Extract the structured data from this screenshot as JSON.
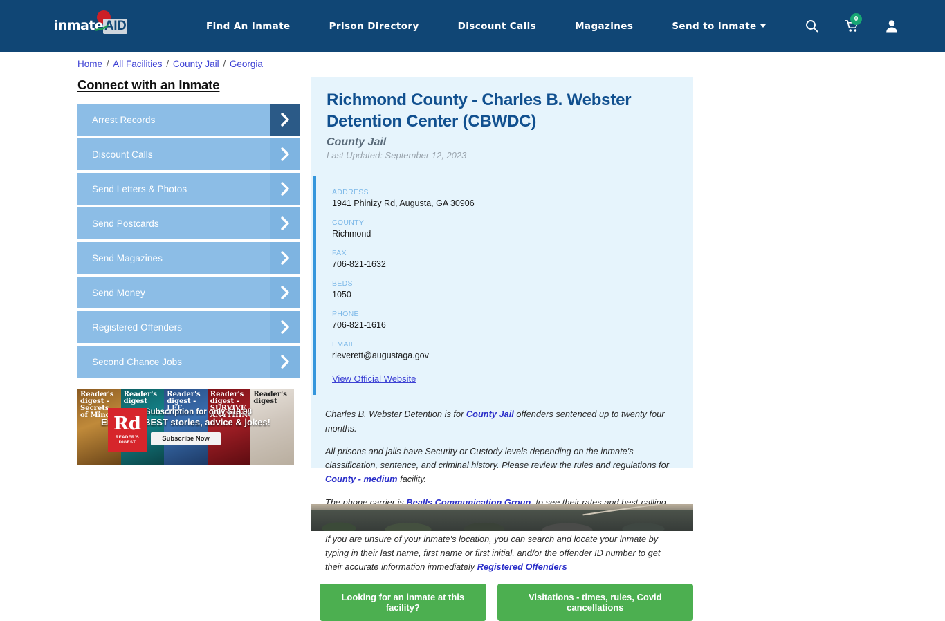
{
  "header": {
    "logo": {
      "word": "inmate",
      "aid": "AID",
      "name": "inmateAID"
    },
    "nav": [
      {
        "label": "Find An Inmate",
        "has_caret": false
      },
      {
        "label": "Prison Directory",
        "has_caret": false
      },
      {
        "label": "Discount Calls",
        "has_caret": false
      },
      {
        "label": "Magazines",
        "has_caret": false
      },
      {
        "label": "Send to Inmate",
        "has_caret": true
      }
    ],
    "icons": {
      "search": "search-icon",
      "cart": "shopping-cart-icon",
      "cart_count": "0",
      "account": "user-account-icon"
    },
    "bg_color": "#104675"
  },
  "breadcrumb": {
    "items": [
      "Home",
      "All Facilities",
      "County Jail",
      "Georgia"
    ],
    "separator": "/"
  },
  "sidebar": {
    "heading": "Connect with an Inmate",
    "items": [
      {
        "label": "Arrest Records",
        "active": true
      },
      {
        "label": "Discount Calls",
        "active": false
      },
      {
        "label": "Send Letters & Photos",
        "active": false
      },
      {
        "label": "Send Postcards",
        "active": false
      },
      {
        "label": "Send Magazines",
        "active": false
      },
      {
        "label": "Send Money",
        "active": false
      },
      {
        "label": "Registered Offenders",
        "active": false
      },
      {
        "label": "Second Chance Jobs",
        "active": false
      }
    ],
    "button_color": "#8cbde6",
    "active_arrow_color": "#2b5a87"
  },
  "ad": {
    "brand": "Reader's Digest",
    "rd_mark": "Rd",
    "rd_sub": "READER'S DIGEST",
    "line1": "1 Year Subscription for only $19.98",
    "line2": "Enjoy the BEST stories, advice & jokes!",
    "cta": "Subscribe Now",
    "covers": [
      "Reader's digest - Secrets of Mind",
      "Reader's digest",
      "Reader's digest - LEE",
      "Reader's digest - SURVIVE ANYTHING",
      "Reader's digest"
    ]
  },
  "facility": {
    "title": "Richmond County - Charles B. Webster Detention Center (CBWDC)",
    "type": "County Jail",
    "last_updated": "Last Updated: September 12, 2023",
    "info": {
      "left": [
        {
          "key": "ADDRESS",
          "value": "1941 Phinizy Rd, Augusta, GA 30906"
        },
        {
          "key": "COUNTY",
          "value": "Richmond"
        },
        {
          "key": "FAX",
          "value": "706-821-1632"
        }
      ],
      "right": [
        {
          "key": "BEDS",
          "value": "1050"
        },
        {
          "key": "PHONE",
          "value": "706-821-1616"
        },
        {
          "key": "EMAIL",
          "value": "rleverett@augustaga.gov"
        }
      ]
    },
    "official_website_link": "View Official Website",
    "accent_bar_color": "#3596dc",
    "card_bg_color": "#e6f4fc"
  },
  "body_copy": {
    "p1_a": "Charles B. Webster Detention is for ",
    "p1_link": "County Jail",
    "p1_b": " offenders sentenced up to twenty four months.",
    "p2_a": "All prisons and jails have Security or Custody levels depending on the inmate's classification, sentence, and criminal history. Please review the rules and regulations for ",
    "p2_link": "County - medium",
    "p2_b": " facility.",
    "p3_a": "The phone carrier is ",
    "p3_link": "Bealls Communication Group",
    "p3_b": ", to see their rates and best-calling plans for your inmate to call you.",
    "p4_a": "If you are unsure of your inmate's location, you can search and locate your inmate by typing in their last name, first name or first initial, and/or the offender ID number to get their accurate information immediately ",
    "p4_link": "Registered Offenders"
  },
  "cta_buttons": [
    {
      "label": "Looking for an inmate at this facility?"
    },
    {
      "label": "Visitations - times, rules, Covid cancellations"
    }
  ],
  "cta_color": "#4caf50",
  "aerial_photo": {
    "alt": "aerial-satellite-view-of-facility"
  }
}
